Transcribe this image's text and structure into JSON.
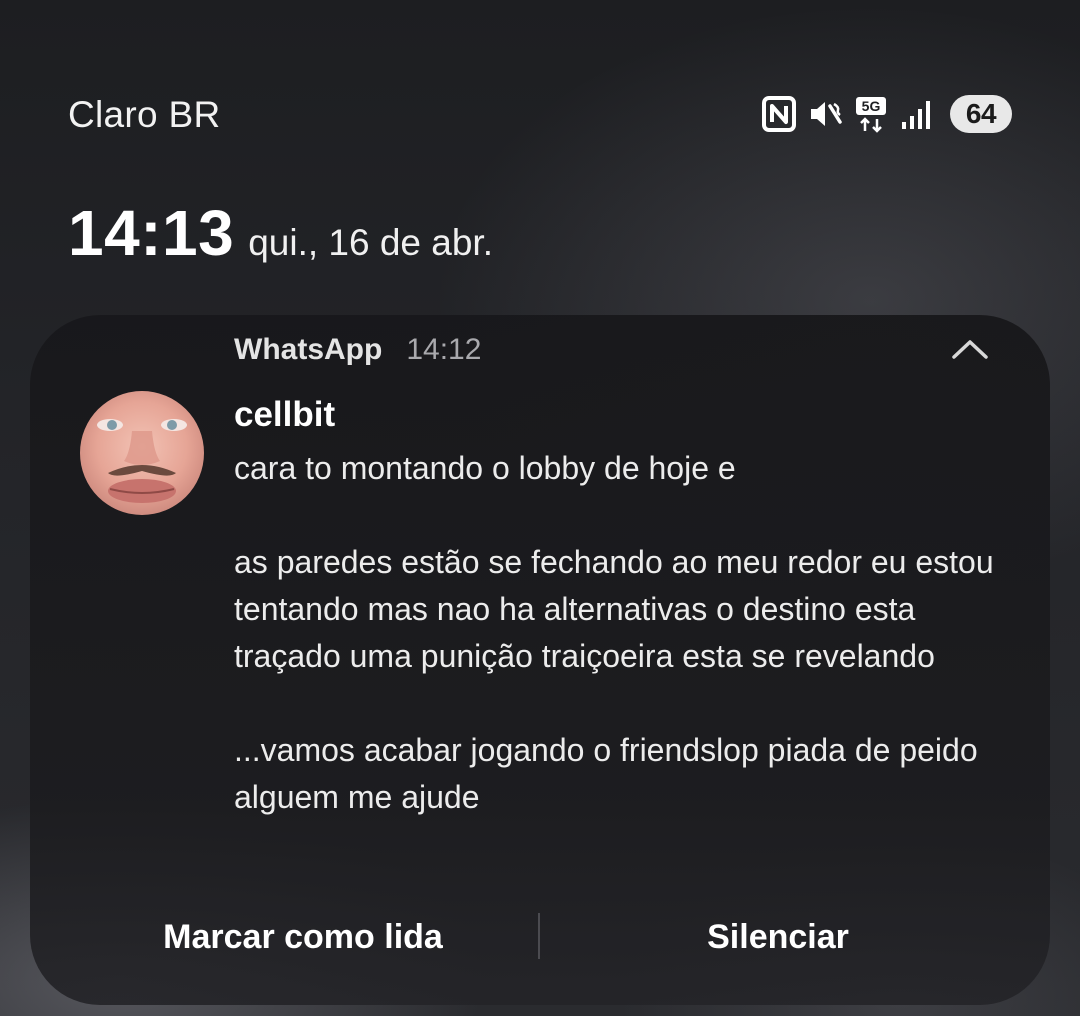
{
  "status_bar": {
    "carrier": "Claro BR",
    "icons": [
      "nfc-icon",
      "vibrate-silent-icon",
      "5g-data-icon",
      "signal-bars-icon"
    ],
    "network_label": "5G",
    "battery_level": "64"
  },
  "lockscreen": {
    "time": "14:13",
    "date": "qui., 16 de abr."
  },
  "notification": {
    "app_name": "WhatsApp",
    "time": "14:12",
    "sender": "cellbit",
    "message_paragraphs": [
      "cara to montando o lobby de hoje e",
      "as paredes estão se fechando ao meu redor eu estou tentando mas nao ha alternativas o destino esta traçado uma punição traiçoeira esta se revelando",
      "...vamos acabar jogando o friendslop piada de peido alguem me ajude"
    ],
    "actions": {
      "mark_read": "Marcar como lida",
      "mute": "Silenciar"
    }
  }
}
